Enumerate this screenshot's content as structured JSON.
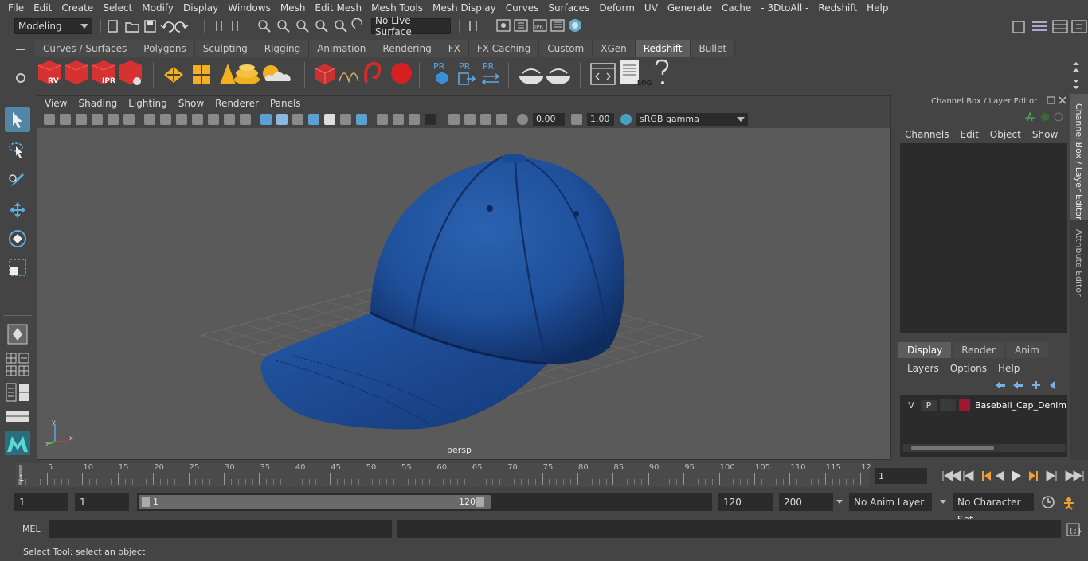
{
  "menu": [
    "File",
    "Edit",
    "Create",
    "Select",
    "Modify",
    "Display",
    "Windows",
    "Mesh",
    "Edit Mesh",
    "Mesh Tools",
    "Mesh Display",
    "Curves",
    "Surfaces",
    "Deform",
    "UV",
    "Generate",
    "Cache",
    "- 3DtoAll -",
    "Redshift",
    "Help"
  ],
  "status": {
    "mode": "Modeling",
    "live_surface": "No Live Surface"
  },
  "shelf_tabs": [
    "Curves / Surfaces",
    "Polygons",
    "Sculpting",
    "Rigging",
    "Animation",
    "Rendering",
    "FX",
    "FX Caching",
    "Custom",
    "XGen",
    "Redshift",
    "Bullet"
  ],
  "active_shelf_tab": "Redshift",
  "shelf_labels": {
    "rv": "RV",
    "ipr": "IPR",
    "pr1": "PR",
    "pr2": "PR",
    "pr3": "PR",
    "log": ".LOG",
    "help": "?"
  },
  "viewport": {
    "menu": [
      "View",
      "Shading",
      "Lighting",
      "Show",
      "Renderer",
      "Panels"
    ],
    "exposure": "0.00",
    "gamma": "1.00",
    "color_space": "sRGB gamma",
    "camera_label": "persp"
  },
  "channel_box": {
    "title": "Channel Box / Layer Editor",
    "menu": [
      "Channels",
      "Edit",
      "Object",
      "Show"
    ],
    "layer_tabs": [
      "Display",
      "Render",
      "Anim"
    ],
    "active_layer_tab": "Display",
    "layer_menu": [
      "Layers",
      "Options",
      "Help"
    ],
    "layer": {
      "v": "V",
      "p": "P",
      "name": "Baseball_Cap_Denim_B",
      "color": "#a01830"
    }
  },
  "side_tabs": [
    "Channel Box / Layer Editor",
    "Attribute Editor"
  ],
  "timeline": {
    "ticks": [
      "5",
      "10",
      "15",
      "20",
      "25",
      "30",
      "35",
      "40",
      "45",
      "50",
      "55",
      "60",
      "65",
      "70",
      "75",
      "80",
      "85",
      "90",
      "95",
      "100",
      "105",
      "110",
      "115",
      "12"
    ],
    "start_marker": "1",
    "current_frame": "1"
  },
  "range": {
    "start": "1",
    "playback_start": "1",
    "slider_start": "1",
    "slider_end": "120",
    "playback_end": "120",
    "end": "200",
    "anim_layer": "No Anim Layer",
    "character_set": "No Character Set"
  },
  "command": {
    "lang": "MEL"
  },
  "help_text": "Select Tool: select an object",
  "colors": {
    "cap": "#1f4f9a",
    "accent": "#5285a6",
    "redshift": "#d42a2a"
  }
}
